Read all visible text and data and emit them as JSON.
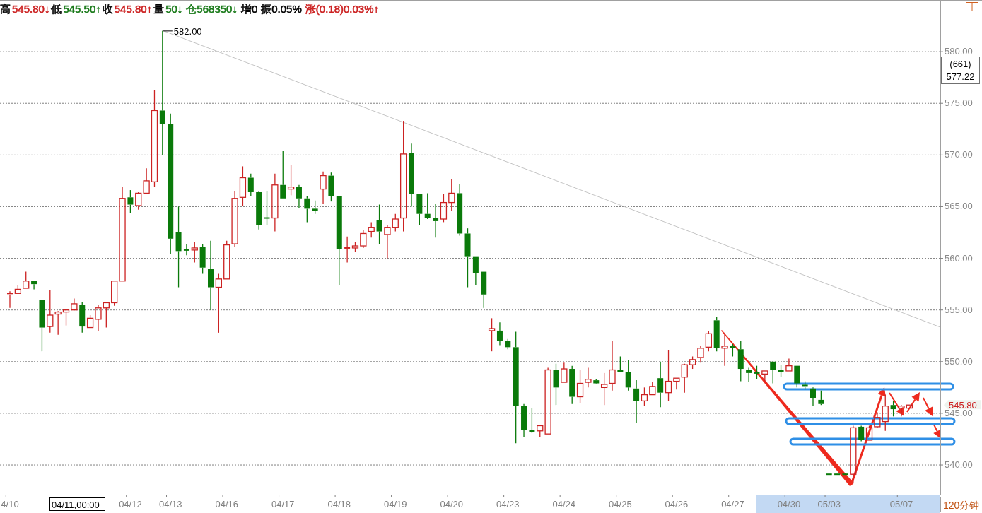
{
  "header": [
    {
      "text": "高",
      "color": "#000000"
    },
    {
      "text": "545.80↓",
      "color": "#cc2222"
    },
    {
      "text": "低",
      "color": "#000000"
    },
    {
      "text": "545.50↑",
      "color": "#1a7a1a"
    },
    {
      "text": "收",
      "color": "#000000"
    },
    {
      "text": "545.80↑",
      "color": "#cc2222"
    },
    {
      "text": "量",
      "color": "#000000"
    },
    {
      "text": "50↓",
      "color": "#1a7a1a"
    },
    {
      "text": "仓568350↓",
      "color": "#1a7a1a"
    },
    {
      "text": "增0",
      "color": "#000000"
    },
    {
      "text": "振0.05%",
      "color": "#000000"
    },
    {
      "text": "涨(0.18)0.03%↑",
      "color": "#cc2222"
    }
  ],
  "cursor": {
    "count": "(661)",
    "price": "577.22",
    "time": "04/11,00:00"
  },
  "last_price": "545.80",
  "period": "120分钟",
  "chart": {
    "chart_data": {
      "type": "candlestick",
      "grid": true,
      "ylim": [
        537.13,
        585.0
      ],
      "yticks": [
        {
          "value": 540,
          "label": "540.00"
        },
        {
          "value": 545,
          "label": "545.00"
        },
        {
          "value": 550,
          "label": "550.00"
        },
        {
          "value": 555,
          "label": "555.00"
        },
        {
          "value": 560,
          "label": "560.00"
        },
        {
          "value": 565,
          "label": "565.00"
        },
        {
          "value": 570,
          "label": "570.00"
        },
        {
          "value": 575,
          "label": "575.00"
        },
        {
          "value": 580,
          "label": "580.00"
        }
      ],
      "categories": [
        "4/10",
        null,
        null,
        null,
        null,
        null,
        null,
        null,
        null,
        null,
        null,
        null,
        null,
        null,
        null,
        "04/12",
        null,
        null,
        null,
        null,
        "04/13",
        null,
        null,
        null,
        null,
        null,
        null,
        "04/16",
        null,
        null,
        null,
        null,
        null,
        null,
        "04/17",
        null,
        null,
        null,
        null,
        null,
        null,
        "04/18",
        null,
        null,
        null,
        null,
        null,
        null,
        "04/19",
        null,
        null,
        null,
        null,
        null,
        null,
        "04/20",
        null,
        null,
        null,
        null,
        null,
        null,
        "04/23",
        null,
        null,
        null,
        null,
        null,
        null,
        "04/24",
        null,
        null,
        null,
        null,
        null,
        null,
        "04/25",
        null,
        null,
        null,
        null,
        null,
        null,
        "04/26",
        null,
        null,
        null,
        null,
        null,
        null,
        "04/27",
        null,
        null,
        null,
        null,
        null,
        null,
        "04/30",
        null,
        null,
        null,
        null,
        "05/03",
        null,
        null,
        null,
        null,
        null,
        null,
        null,
        null,
        "05/07",
        null
      ],
      "annotations": [
        {
          "text": "582.00"
        }
      ],
      "ohlc": [
        [
          556.5,
          556.8,
          555.2,
          556.6
        ],
        [
          556.6,
          557.4,
          556.6,
          557.0
        ],
        [
          557.1,
          558.7,
          557.1,
          557.8
        ],
        [
          557.8,
          557.8,
          557.0,
          557.5
        ],
        [
          556.0,
          556.0,
          551.0,
          553.3
        ],
        [
          553.4,
          556.9,
          552.8,
          554.5
        ],
        [
          554.6,
          554.9,
          552.6,
          554.8
        ],
        [
          554.8,
          555.0,
          553.5,
          555.0
        ],
        [
          555.0,
          556.1,
          555.0,
          555.6
        ],
        [
          555.5,
          555.8,
          552.8,
          553.4
        ],
        [
          553.3,
          554.5,
          553.3,
          554.2
        ],
        [
          554.1,
          555.5,
          553.0,
          555.2
        ],
        [
          555.2,
          555.7,
          553.3,
          555.7
        ],
        [
          555.7,
          557.8,
          555.4,
          557.8
        ],
        [
          557.8,
          566.9,
          557.8,
          565.8
        ],
        [
          565.9,
          566.6,
          564.4,
          565.2
        ],
        [
          565.1,
          566.4,
          564.7,
          566.3
        ],
        [
          566.3,
          568.7,
          566.3,
          567.5
        ],
        [
          567.4,
          576.3,
          566.9,
          574.3
        ],
        [
          574.3,
          582.0,
          570.0,
          573.0
        ],
        [
          573.0,
          574.0,
          560.4,
          561.9
        ],
        [
          562.5,
          565.0,
          557.2,
          560.7
        ],
        [
          560.8,
          561.4,
          560.3,
          560.8
        ],
        [
          560.8,
          561.6,
          559.6,
          561.0
        ],
        [
          561.1,
          561.4,
          558.5,
          559.1
        ],
        [
          559.0,
          561.7,
          555.0,
          557.2
        ],
        [
          557.2,
          558.5,
          552.8,
          558.0
        ],
        [
          558.0,
          561.7,
          558.0,
          561.3
        ],
        [
          561.4,
          566.5,
          561.1,
          565.8
        ],
        [
          565.9,
          568.9,
          565.1,
          567.8
        ],
        [
          567.8,
          568.2,
          566.0,
          566.4
        ],
        [
          566.4,
          566.5,
          562.8,
          563.2
        ],
        [
          563.9,
          566.5,
          563.2,
          563.9
        ],
        [
          563.9,
          568.2,
          562.6,
          567.1
        ],
        [
          567.1,
          570.4,
          565.8,
          565.8
        ],
        [
          566.7,
          569.0,
          566.1,
          566.9
        ],
        [
          566.9,
          567.1,
          564.9,
          565.8
        ],
        [
          565.8,
          566.0,
          563.5,
          564.8
        ],
        [
          564.8,
          565.6,
          564.3,
          564.6
        ],
        [
          566.7,
          568.4,
          565.3,
          568.0
        ],
        [
          568.0,
          568.3,
          565.5,
          566.0
        ],
        [
          566.0,
          566.0,
          557.4,
          560.9
        ],
        [
          560.9,
          562.1,
          559.6,
          561.0
        ],
        [
          561.0,
          561.6,
          560.6,
          561.2
        ],
        [
          561.2,
          562.7,
          561.0,
          562.4
        ],
        [
          562.6,
          563.5,
          562.0,
          563.0
        ],
        [
          563.7,
          565.2,
          561.4,
          562.6
        ],
        [
          562.3,
          563.2,
          560.0,
          563.0
        ],
        [
          563.0,
          564.3,
          562.6,
          563.8
        ],
        [
          563.9,
          573.3,
          562.6,
          570.1
        ],
        [
          570.2,
          571.1,
          565.0,
          566.2
        ],
        [
          566.2,
          566.2,
          563.2,
          564.3
        ],
        [
          564.3,
          566.3,
          563.8,
          563.9
        ],
        [
          563.9,
          565.3,
          562.0,
          563.6
        ],
        [
          563.8,
          566.2,
          563.5,
          565.4
        ],
        [
          565.4,
          567.7,
          564.6,
          566.3
        ],
        [
          566.3,
          567.2,
          562.2,
          562.4
        ],
        [
          562.4,
          562.9,
          557.2,
          560.2
        ],
        [
          560.2,
          560.2,
          557.4,
          558.6
        ],
        [
          558.7,
          558.7,
          555.2,
          556.5
        ],
        [
          553.0,
          554.2,
          551.0,
          553.2
        ],
        [
          553.0,
          553.8,
          551.6,
          552.0
        ],
        [
          552.0,
          552.2,
          551.2,
          551.4
        ],
        [
          551.4,
          552.9,
          542.1,
          545.7
        ],
        [
          545.7,
          545.9,
          542.7,
          543.4
        ],
        [
          543.4,
          545.5,
          543.1,
          543.2
        ],
        [
          543.3,
          543.8,
          542.7,
          543.8
        ],
        [
          543.0,
          549.4,
          543.0,
          549.2
        ],
        [
          549.2,
          549.8,
          545.8,
          547.5
        ],
        [
          548.0,
          549.9,
          548.0,
          549.3
        ],
        [
          549.3,
          549.6,
          545.9,
          546.6
        ],
        [
          546.6,
          549.2,
          546.0,
          547.9
        ],
        [
          548.0,
          549.4,
          547.5,
          548.3
        ],
        [
          548.2,
          548.3,
          547.8,
          547.9
        ],
        [
          547.5,
          548.9,
          545.8,
          547.8
        ],
        [
          547.9,
          552.0,
          547.2,
          549.2
        ],
        [
          549.2,
          550.5,
          549.0,
          549.0
        ],
        [
          549.0,
          550.2,
          547.2,
          547.5
        ],
        [
          547.4,
          548.2,
          544.1,
          546.2
        ],
        [
          546.2,
          547.5,
          545.7,
          546.8
        ],
        [
          546.8,
          548.0,
          546.8,
          547.6
        ],
        [
          548.4,
          550.0,
          545.6,
          547.0
        ],
        [
          547.0,
          551.1,
          546.2,
          548.1
        ],
        [
          548.1,
          548.4,
          547.3,
          548.4
        ],
        [
          548.5,
          549.8,
          547.0,
          549.7
        ],
        [
          549.7,
          550.5,
          549.3,
          550.2
        ],
        [
          550.4,
          551.5,
          549.9,
          551.3
        ],
        [
          551.4,
          553.0,
          551.0,
          552.7
        ],
        [
          554.0,
          554.3,
          551.0,
          551.3
        ],
        [
          551.3,
          552.8,
          549.6,
          551.5
        ],
        [
          551.5,
          551.7,
          550.5,
          551.3
        ],
        [
          551.2,
          552.0,
          548.1,
          549.3
        ],
        [
          549.2,
          549.4,
          548.0,
          548.9
        ],
        [
          548.9,
          549.6,
          548.3,
          548.9
        ],
        [
          548.8,
          549.1,
          548.1,
          549.1
        ],
        [
          550.0,
          550.0,
          547.9,
          549.2
        ],
        [
          549.2,
          549.7,
          548.5,
          549.0
        ],
        [
          549.1,
          550.3,
          549.1,
          549.6
        ],
        [
          549.6,
          549.6,
          547.5,
          547.9
        ],
        [
          547.7,
          548.1,
          547.3,
          547.6
        ],
        [
          547.4,
          547.5,
          545.7,
          546.5
        ],
        [
          546.3,
          547.2,
          545.8,
          545.9
        ],
        [
          539.1,
          539.1,
          539.1,
          539.1
        ],
        [
          539.1,
          539.1,
          539.1,
          539.1
        ],
        [
          539.1,
          539.1,
          539.1,
          539.1
        ],
        [
          539.1,
          543.8,
          538.2,
          543.6
        ],
        [
          543.7,
          543.8,
          542.3,
          542.4
        ],
        [
          542.4,
          543.8,
          542.4,
          543.6
        ],
        [
          543.7,
          545.1,
          543.6,
          544.6
        ],
        [
          544.2,
          546.8,
          543.3,
          545.7
        ],
        [
          545.8,
          546.2,
          544.7,
          545.4
        ],
        [
          545.5,
          545.8,
          544.7,
          545.7
        ],
        [
          545.5,
          545.8,
          545.5,
          545.8
        ]
      ]
    }
  }
}
